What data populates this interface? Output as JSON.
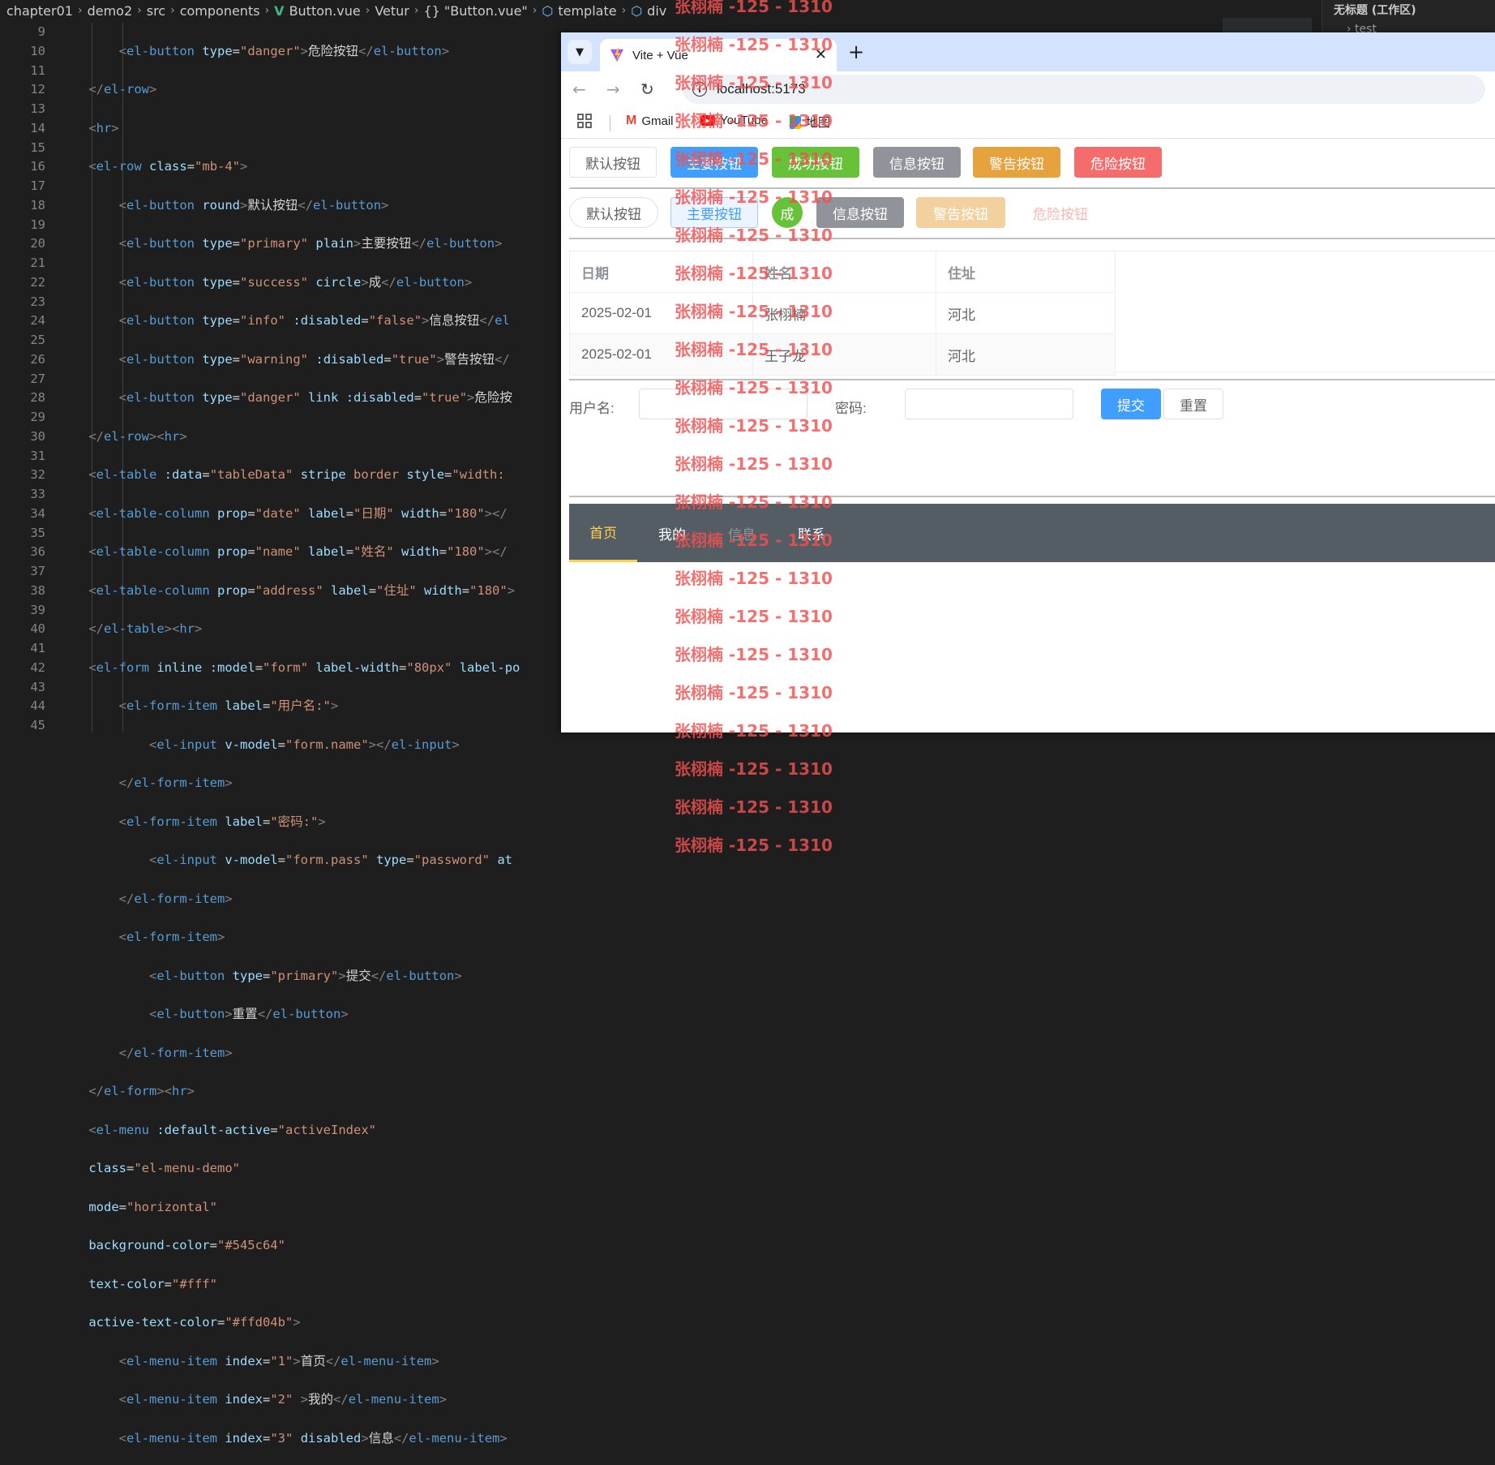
{
  "editor": {
    "breadcrumb": [
      "chapter01",
      "demo2",
      "src",
      "components",
      "Button.vue",
      "Vetur",
      "{} \"Button.vue\"",
      "template",
      "div"
    ],
    "line_numbers": [
      "9",
      "10",
      "11",
      "12",
      "13",
      "14",
      "15",
      "16",
      "17",
      "18",
      "19",
      "20",
      "21",
      "22",
      "23",
      "24",
      "25",
      "26",
      "27",
      "28",
      "29",
      "30",
      "31",
      "32",
      "33",
      "34",
      "35",
      "36",
      "37",
      "38",
      "39",
      "40",
      "41",
      "42",
      "43",
      "44",
      "45"
    ],
    "explorer_title": "无标题 (工作区)",
    "explorer_item": "test"
  },
  "browser": {
    "tab_title": "Vite + Vue",
    "url": "localhost:5173",
    "bookmarks": [
      "Gmail",
      "YouTube",
      "地图"
    ]
  },
  "page": {
    "row1": [
      "默认按钮",
      "主要按钮",
      "成功按钮",
      "信息按钮",
      "警告按钮",
      "危险按钮"
    ],
    "row2": [
      "默认按钮",
      "主要按钮",
      "成",
      "信息按钮",
      "警告按钮",
      "危险按钮"
    ],
    "table": {
      "headers": [
        "日期",
        "姓名",
        "住址"
      ],
      "rows": [
        [
          "2025-02-01",
          "张栩楠",
          "河北"
        ],
        [
          "2025-02-01",
          "王子龙",
          "河北"
        ]
      ]
    },
    "form": {
      "username_label": "用户名:",
      "password_label": "密码:",
      "submit": "提交",
      "reset": "重置"
    },
    "menu": {
      "items": [
        "首页",
        "我的",
        "信息",
        "联系"
      ],
      "background": "#545c64",
      "active_color": "#ffd04b"
    }
  },
  "watermark": "张栩楠 -125 - 1310"
}
